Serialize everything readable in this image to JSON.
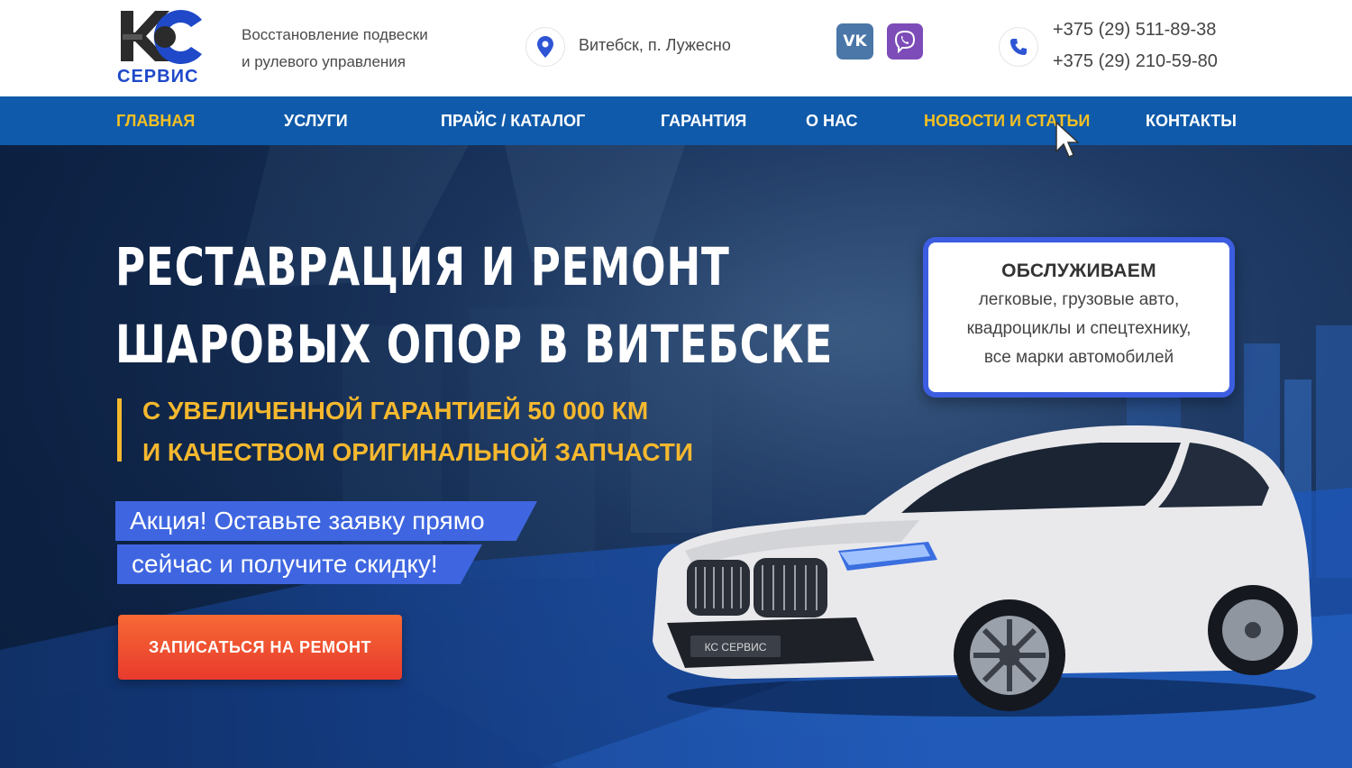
{
  "header": {
    "logo_text": "СЕРВИС",
    "tagline_line1": "Восстановление подвески",
    "tagline_line2": "и рулевого управления",
    "address": "Витебск, п. Лужесно",
    "social": {
      "vk_label": "VK",
      "viber_icon": "viber-icon"
    },
    "phone_1": "+375 (29) 511-89-38",
    "phone_2": "+375 (29) 210-59-80"
  },
  "nav": {
    "items": [
      {
        "label": "ГЛАВНАЯ"
      },
      {
        "label": "УСЛУГИ"
      },
      {
        "label": "ПРАЙС / КАТАЛОГ"
      },
      {
        "label": "ГАРАНТИЯ"
      },
      {
        "label": "О НАС"
      },
      {
        "label": "НОВОСТИ И СТАТЬИ"
      },
      {
        "label": "КОНТАКТЫ"
      }
    ],
    "active_index": 0,
    "hovered_index": 5
  },
  "hero": {
    "title_line1": "РЕСТАВРАЦИЯ И РЕМОНТ",
    "title_line2": "ШАРОВЫХ ОПОР В ВИТЕБСКЕ",
    "subtitle_line1": "С УВЕЛИЧЕННОЙ ГАРАНТИЕЙ 50 000 КМ",
    "subtitle_line2": "И КАЧЕСТВОМ ОРИГИНАЛЬНОЙ ЗАПЧАСТИ",
    "promo_line1": "Акция!  Оставьте заявку прямо",
    "promo_line2": "сейчас и получите скидку!",
    "cta_label": "ЗАПИСАТЬСЯ НА РЕМОНТ",
    "service_box": {
      "title": "ОБСЛУЖИВАЕМ",
      "line1": "легковые, грузовые авто,",
      "line2": "квадроциклы и спецтехнику,",
      "line3": "все марки автомобилей"
    },
    "car_plate_text": "КС СЕРВИС"
  },
  "colors": {
    "brand_blue": "#1f49c9",
    "nav_blue": "#0f5aaa",
    "accent_yellow": "#f5b82e",
    "promo_blue": "#3f66e0",
    "cta_orange": "#f05a32"
  }
}
